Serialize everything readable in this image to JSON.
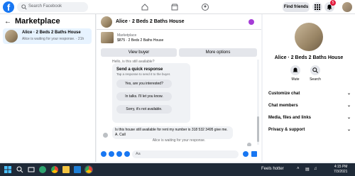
{
  "topnav": {
    "logo": "f",
    "search_placeholder": "Search Facebook",
    "find_friends": "Find friends",
    "notification_count": "5"
  },
  "left": {
    "back_icon": "arrow-left-icon",
    "title": "Marketplace",
    "conversation": {
      "name": "Alice · 2 Beds 2 Baths House",
      "status": "Alice is waiting for your response. · 21h"
    }
  },
  "center": {
    "header_name": "Alice · 2 Beds 2 Baths House",
    "listing_label": "Marketplace",
    "listing_value": "$875 · 2 Beds 2 Baths House",
    "view_buyer": "View buyer",
    "more_options": "More options",
    "cut_text": "Hello, is this still available?",
    "quick_title": "Send a quick response",
    "quick_sub": "Tap a response to send it to the buyer.",
    "quick_options": [
      "Yes, are you interested?",
      "In talks. I'll let you know.",
      "Sorry, it's not available."
    ],
    "message": "Is this  house still available for rent my  number is 318 532 3495 give me. A. Call",
    "waiting": "Alice is waiting for your response.",
    "composer_placeholder": "Aa"
  },
  "right": {
    "name": "Alice · 2 Beds 2 Baths House",
    "mute": "Mute",
    "search": "Search",
    "rows": [
      "Customize chat",
      "Chat members",
      "Media, files and links",
      "Privacy & support"
    ]
  },
  "taskbar": {
    "weather": "Feels hotter",
    "time": "4:15 PM",
    "date": "7/3/2021"
  },
  "colors": {
    "accent": "#1877f2",
    "selected_bg": "#e7f3ff",
    "badge": "#e41e3f"
  }
}
